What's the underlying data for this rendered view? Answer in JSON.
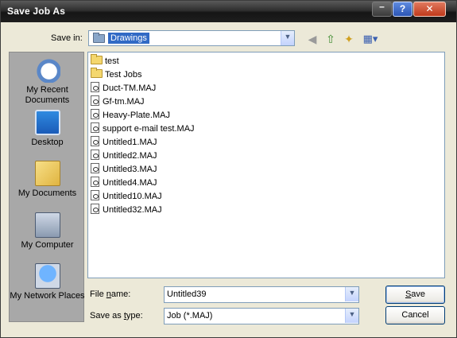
{
  "window": {
    "title": "Save Job As"
  },
  "titlebar": {
    "minimize_glyph": "–",
    "help_glyph": "?",
    "close_glyph": "✕"
  },
  "savein": {
    "label": "Save in:",
    "value": "Drawings"
  },
  "toolbar": {
    "back_icon": "back-arrow-icon",
    "up_icon": "up-folder-icon",
    "new_folder_icon": "new-folder-icon",
    "views_icon": "views-menu-icon"
  },
  "places": [
    {
      "label": "My Recent Documents",
      "icon": "recent-documents-icon"
    },
    {
      "label": "Desktop",
      "icon": "desktop-icon"
    },
    {
      "label": "My Documents",
      "icon": "my-documents-icon"
    },
    {
      "label": "My Computer",
      "icon": "my-computer-icon"
    },
    {
      "label": "My Network Places",
      "icon": "network-places-icon"
    }
  ],
  "files": [
    {
      "name": "test",
      "type": "folder"
    },
    {
      "name": "Test Jobs",
      "type": "folder"
    },
    {
      "name": "Duct-TM.MAJ",
      "type": "file"
    },
    {
      "name": "Gf-tm.MAJ",
      "type": "file"
    },
    {
      "name": "Heavy-Plate.MAJ",
      "type": "file"
    },
    {
      "name": "support e-mail test.MAJ",
      "type": "file"
    },
    {
      "name": "Untitled1.MAJ",
      "type": "file"
    },
    {
      "name": "Untitled2.MAJ",
      "type": "file"
    },
    {
      "name": "Untitled3.MAJ",
      "type": "file"
    },
    {
      "name": "Untitled4.MAJ",
      "type": "file"
    },
    {
      "name": "Untitled10.MAJ",
      "type": "file"
    },
    {
      "name": "Untitled32.MAJ",
      "type": "file"
    }
  ],
  "filename": {
    "label_pre": "File ",
    "label_key": "n",
    "label_post": "ame:",
    "value": "Untitled39"
  },
  "savetype": {
    "label_pre": "Save as ",
    "label_key": "t",
    "label_post": "ype:",
    "value": "Job (*.MAJ)"
  },
  "buttons": {
    "save_key": "S",
    "save_rest": "ave",
    "cancel": "Cancel"
  },
  "dropdown_glyph": "▼",
  "colors": {
    "selection": "#316ac5",
    "dialog_bg": "#ece9d8",
    "places_bg": "#a8a8a8"
  }
}
